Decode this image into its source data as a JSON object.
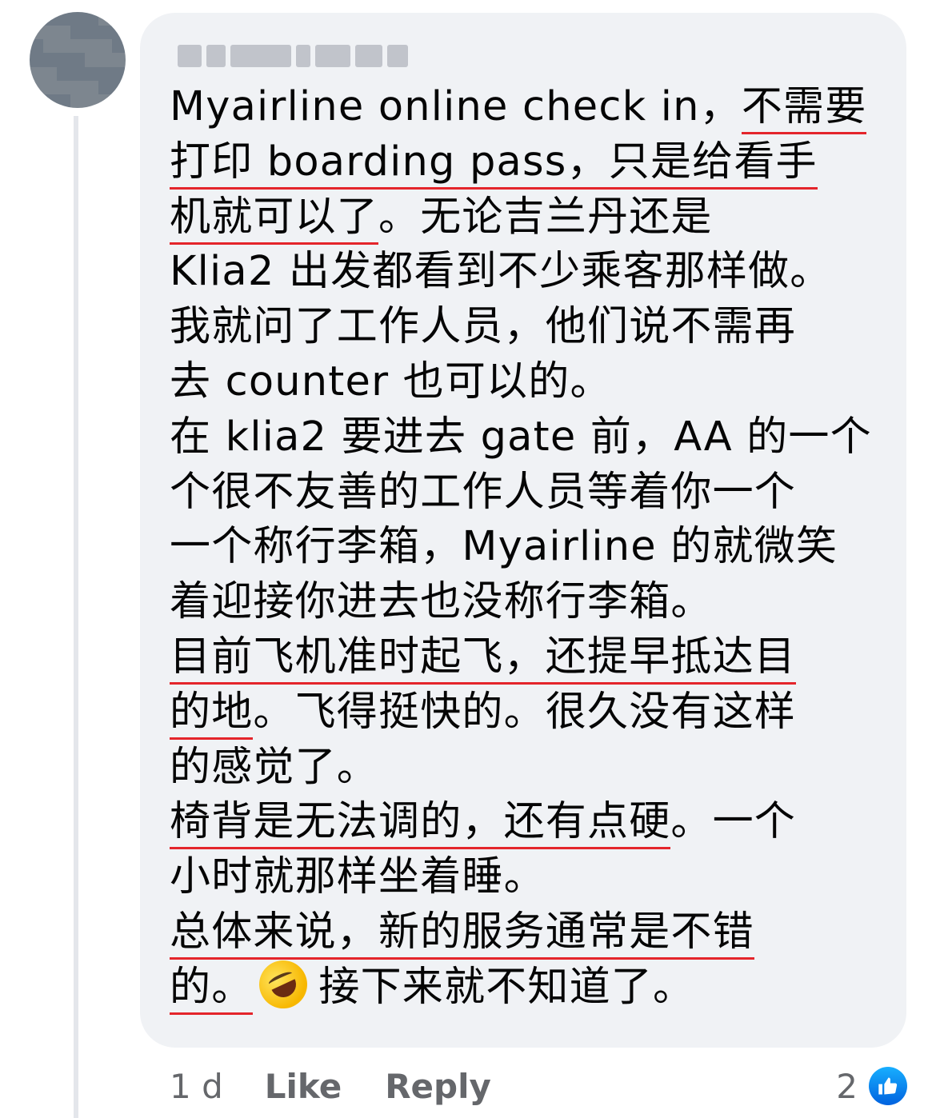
{
  "comment": {
    "author_name": "",
    "lines": [
      [
        {
          "t": "Myairline online check in，",
          "u": false
        },
        {
          "t": "不需要",
          "u": true
        }
      ],
      [
        {
          "t": "打印 boarding pass，只是给看手",
          "u": true
        }
      ],
      [
        {
          "t": "机就可以了",
          "u": true
        },
        {
          "t": "。无论吉兰丹还是",
          "u": false
        }
      ],
      [
        {
          "t": "Klia2 出发都看到不少乘客那样做。",
          "u": false
        }
      ],
      [
        {
          "t": "我就问了工作人员，他们说不需再",
          "u": false
        }
      ],
      [
        {
          "t": "去 counter 也可以的。",
          "u": false
        }
      ],
      [
        {
          "t": "在 klia2 要进去 gate 前，AA 的一个",
          "u": false
        }
      ],
      [
        {
          "t": "个很不友善的工作人员等着你一个",
          "u": false
        }
      ],
      [
        {
          "t": "一个称行李箱，Myairline 的就微笑",
          "u": false
        }
      ],
      [
        {
          "t": "着迎接你进去也没称行李箱。",
          "u": false
        }
      ],
      [
        {
          "t": "目前飞机准时起飞，还提早抵达目",
          "u": true
        }
      ],
      [
        {
          "t": "的地",
          "u": true
        },
        {
          "t": "。飞得挺快的。很久没有这样",
          "u": false
        }
      ],
      [
        {
          "t": "的感觉了。",
          "u": false
        }
      ],
      [
        {
          "t": "椅背是无法调的，还有点硬",
          "u": true
        },
        {
          "t": "。一个",
          "u": false
        }
      ],
      [
        {
          "t": "小时就那样坐着睡。",
          "u": false
        }
      ],
      [
        {
          "t": "总体来说，新的服务通常是不错",
          "u": true
        }
      ],
      [
        {
          "t": "的。",
          "u": true
        },
        {
          "emoji": "rolling-on-the-floor-laughing-emoji"
        },
        {
          "t": "接下来就不知道了。",
          "u": false
        }
      ]
    ]
  },
  "footer": {
    "time": "1 d",
    "like_label": "Like",
    "reply_label": "Reply",
    "reaction_count": "2",
    "reaction_icon": "like-reaction-icon"
  },
  "colors": {
    "bubble": "#f0f2f5",
    "underline": "#e4252b",
    "meta_text": "#65676b",
    "like_blue": "#1877f2"
  }
}
